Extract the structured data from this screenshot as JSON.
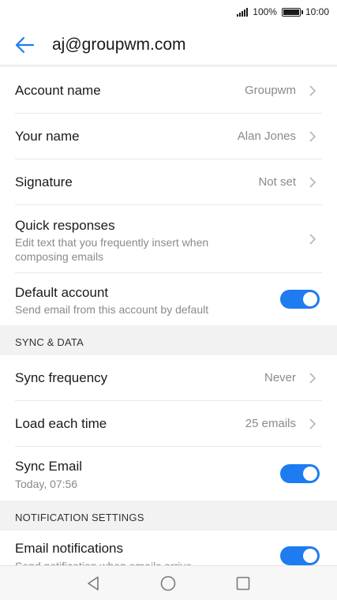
{
  "status_bar": {
    "battery_percent": "100%",
    "battery_level": 1.0,
    "time": "10:00"
  },
  "app_bar": {
    "title": "aj@groupwm.com",
    "back_icon": "arrow-left-icon"
  },
  "colors": {
    "accent": "#1e7cf0",
    "section_bg": "#f2f2f2",
    "secondary_text": "#8a8a8a"
  },
  "settings": {
    "account_name": {
      "label": "Account name",
      "value": "Groupwm"
    },
    "your_name": {
      "label": "Your name",
      "value": "Alan Jones"
    },
    "signature": {
      "label": "Signature",
      "value": "Not set"
    },
    "quick_responses": {
      "label": "Quick responses",
      "subtitle": "Edit text that you frequently insert when composing emails"
    },
    "default_account": {
      "label": "Default account",
      "subtitle": "Send email from this account by default",
      "enabled": true
    }
  },
  "sync_section": {
    "header": "SYNC & DATA",
    "sync_frequency": {
      "label": "Sync frequency",
      "value": "Never"
    },
    "load_each_time": {
      "label": "Load each time",
      "value": "25 emails"
    },
    "sync_email": {
      "label": "Sync Email",
      "subtitle": "Today, 07:56",
      "enabled": true
    }
  },
  "notification_section": {
    "header": "NOTIFICATION SETTINGS",
    "email_notifications": {
      "label": "Email notifications",
      "subtitle": "Send notification when emails arrive",
      "enabled": true
    }
  },
  "nav_bar": {
    "back": "triangle-back-icon",
    "home": "circle-home-icon",
    "recents": "square-recents-icon"
  }
}
